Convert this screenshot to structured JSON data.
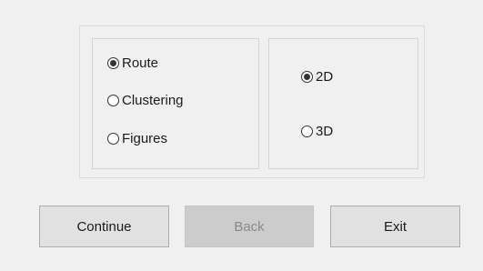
{
  "mode_group": {
    "options": [
      {
        "label": "Route",
        "selected": true
      },
      {
        "label": "Clustering",
        "selected": false
      },
      {
        "label": "Figures",
        "selected": false
      }
    ]
  },
  "dimension_group": {
    "options": [
      {
        "label": "2D",
        "selected": true
      },
      {
        "label": "3D",
        "selected": false
      }
    ]
  },
  "buttons": {
    "continue_label": "Continue",
    "back_label": "Back",
    "back_enabled": false,
    "exit_label": "Exit"
  }
}
